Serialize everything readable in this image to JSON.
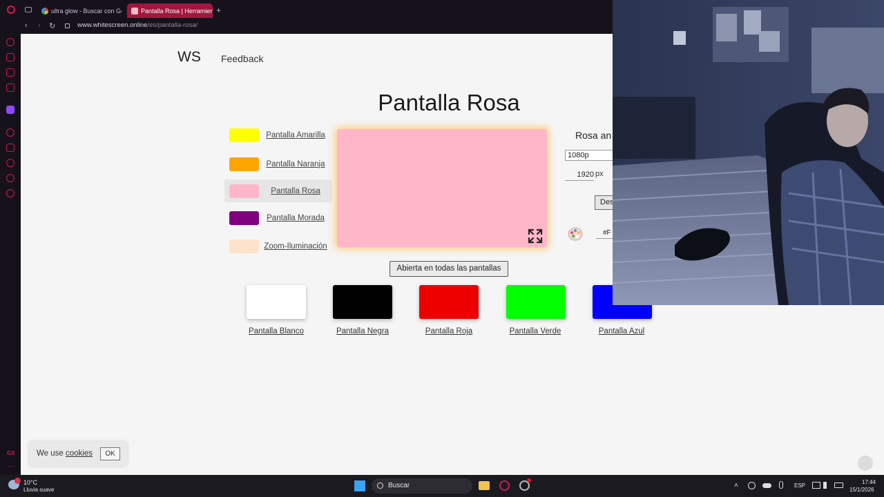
{
  "browser": {
    "tabs": [
      {
        "title": "ultra glow - Buscar con Goo",
        "active": false
      },
      {
        "title": "Pantalla Rosa | Herramien",
        "active": true
      }
    ],
    "new_tab": "+",
    "url_domain": "www.whitescreen.online",
    "url_path": "/es/pantalla-rosa/"
  },
  "header": {
    "logo": "WS",
    "feedback": "Feedback"
  },
  "page_title": "Pantalla Rosa",
  "menu": [
    {
      "label": "Pantalla Amarilla",
      "color": "#ffff00"
    },
    {
      "label": "Pantalla Naranja",
      "color": "#ffa500"
    },
    {
      "label": "Pantalla Rosa",
      "color": "#ffb6c8"
    },
    {
      "label": "Pantalla Morada",
      "color": "#800080"
    },
    {
      "label": "Zoom-Iluminación",
      "color": "#fde3cc"
    }
  ],
  "preview": {
    "color": "#ffb6c8"
  },
  "open_all_button": "Abierta en todas las pantallas",
  "big_swatches": [
    {
      "label": "Pantalla Blanco",
      "color": "#ffffff"
    },
    {
      "label": "Pantalla Negra",
      "color": "#000000"
    },
    {
      "label": "Pantalla Roja",
      "color": "#ee0000"
    },
    {
      "label": "Pantalla Verde",
      "color": "#00ff00"
    },
    {
      "label": "Pantalla Azul",
      "color": "#0000ff"
    }
  ],
  "controls": {
    "title": "Rosa an",
    "resolution": "1080p",
    "width_value": "1920",
    "unit": "px",
    "download_label": "Des",
    "hex_value": "#F"
  },
  "cookie": {
    "text": "We use",
    "link": "cookies",
    "ok": "OK"
  },
  "taskbar": {
    "weather_temp": "10°C",
    "weather_desc": "Lluvia suave",
    "search_placeholder": "Buscar",
    "lang": "ESP",
    "time": "17:44",
    "date": "15/1/2026"
  }
}
